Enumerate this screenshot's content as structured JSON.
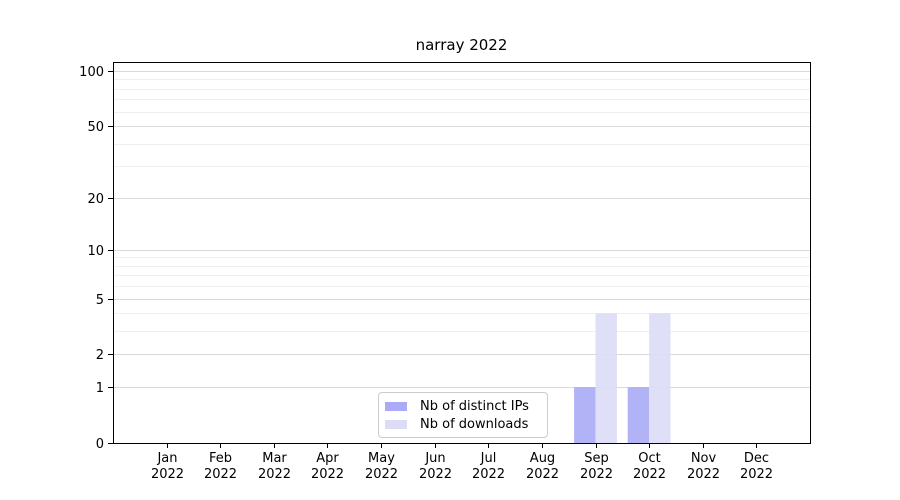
{
  "chart_data": {
    "type": "bar",
    "title": "narray 2022",
    "categories": [
      "Jan",
      "Feb",
      "Mar",
      "Apr",
      "May",
      "Jun",
      "Jul",
      "Aug",
      "Sep",
      "Oct",
      "Nov",
      "Dec"
    ],
    "category_year": "2022",
    "series": [
      {
        "name": "Nb of distinct IPs",
        "color": "#aaaaf6",
        "values": [
          0,
          0,
          0,
          0,
          0,
          0,
          0,
          0,
          1,
          1,
          0,
          0
        ]
      },
      {
        "name": "Nb of downloads",
        "color": "#dcdcf6",
        "values": [
          0,
          0,
          0,
          0,
          0,
          0,
          0,
          0,
          4,
          4,
          0,
          0
        ]
      }
    ],
    "yticks": [
      0,
      1,
      2,
      5,
      10,
      20,
      50,
      100
    ],
    "minor_gridlines": [
      3,
      4,
      6,
      7,
      8,
      9,
      30,
      40,
      60,
      70,
      80,
      90
    ],
    "ylim": [
      0,
      112
    ],
    "yscale": "log1p",
    "grid": true,
    "legend": {
      "position": "lower center"
    }
  },
  "colors": {
    "major_grid": "#d9d9d9",
    "minor_grid": "#efefef",
    "spine": "#000000",
    "text": "#000000"
  }
}
